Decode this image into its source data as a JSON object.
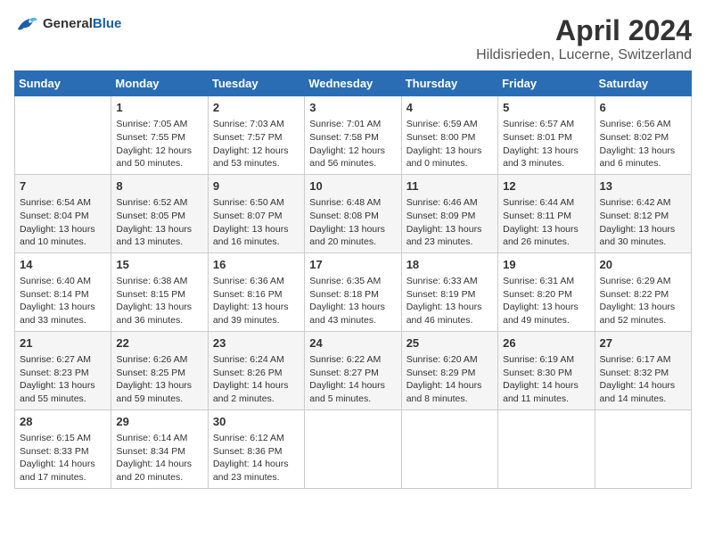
{
  "header": {
    "logo_general": "General",
    "logo_blue": "Blue",
    "month": "April 2024",
    "location": "Hildisrieden, Lucerne, Switzerland"
  },
  "weekdays": [
    "Sunday",
    "Monday",
    "Tuesday",
    "Wednesday",
    "Thursday",
    "Friday",
    "Saturday"
  ],
  "weeks": [
    [
      {
        "day": "",
        "sunrise": "",
        "sunset": "",
        "daylight": ""
      },
      {
        "day": "1",
        "sunrise": "Sunrise: 7:05 AM",
        "sunset": "Sunset: 7:55 PM",
        "daylight": "Daylight: 12 hours and 50 minutes."
      },
      {
        "day": "2",
        "sunrise": "Sunrise: 7:03 AM",
        "sunset": "Sunset: 7:57 PM",
        "daylight": "Daylight: 12 hours and 53 minutes."
      },
      {
        "day": "3",
        "sunrise": "Sunrise: 7:01 AM",
        "sunset": "Sunset: 7:58 PM",
        "daylight": "Daylight: 12 hours and 56 minutes."
      },
      {
        "day": "4",
        "sunrise": "Sunrise: 6:59 AM",
        "sunset": "Sunset: 8:00 PM",
        "daylight": "Daylight: 13 hours and 0 minutes."
      },
      {
        "day": "5",
        "sunrise": "Sunrise: 6:57 AM",
        "sunset": "Sunset: 8:01 PM",
        "daylight": "Daylight: 13 hours and 3 minutes."
      },
      {
        "day": "6",
        "sunrise": "Sunrise: 6:56 AM",
        "sunset": "Sunset: 8:02 PM",
        "daylight": "Daylight: 13 hours and 6 minutes."
      }
    ],
    [
      {
        "day": "7",
        "sunrise": "Sunrise: 6:54 AM",
        "sunset": "Sunset: 8:04 PM",
        "daylight": "Daylight: 13 hours and 10 minutes."
      },
      {
        "day": "8",
        "sunrise": "Sunrise: 6:52 AM",
        "sunset": "Sunset: 8:05 PM",
        "daylight": "Daylight: 13 hours and 13 minutes."
      },
      {
        "day": "9",
        "sunrise": "Sunrise: 6:50 AM",
        "sunset": "Sunset: 8:07 PM",
        "daylight": "Daylight: 13 hours and 16 minutes."
      },
      {
        "day": "10",
        "sunrise": "Sunrise: 6:48 AM",
        "sunset": "Sunset: 8:08 PM",
        "daylight": "Daylight: 13 hours and 20 minutes."
      },
      {
        "day": "11",
        "sunrise": "Sunrise: 6:46 AM",
        "sunset": "Sunset: 8:09 PM",
        "daylight": "Daylight: 13 hours and 23 minutes."
      },
      {
        "day": "12",
        "sunrise": "Sunrise: 6:44 AM",
        "sunset": "Sunset: 8:11 PM",
        "daylight": "Daylight: 13 hours and 26 minutes."
      },
      {
        "day": "13",
        "sunrise": "Sunrise: 6:42 AM",
        "sunset": "Sunset: 8:12 PM",
        "daylight": "Daylight: 13 hours and 30 minutes."
      }
    ],
    [
      {
        "day": "14",
        "sunrise": "Sunrise: 6:40 AM",
        "sunset": "Sunset: 8:14 PM",
        "daylight": "Daylight: 13 hours and 33 minutes."
      },
      {
        "day": "15",
        "sunrise": "Sunrise: 6:38 AM",
        "sunset": "Sunset: 8:15 PM",
        "daylight": "Daylight: 13 hours and 36 minutes."
      },
      {
        "day": "16",
        "sunrise": "Sunrise: 6:36 AM",
        "sunset": "Sunset: 8:16 PM",
        "daylight": "Daylight: 13 hours and 39 minutes."
      },
      {
        "day": "17",
        "sunrise": "Sunrise: 6:35 AM",
        "sunset": "Sunset: 8:18 PM",
        "daylight": "Daylight: 13 hours and 43 minutes."
      },
      {
        "day": "18",
        "sunrise": "Sunrise: 6:33 AM",
        "sunset": "Sunset: 8:19 PM",
        "daylight": "Daylight: 13 hours and 46 minutes."
      },
      {
        "day": "19",
        "sunrise": "Sunrise: 6:31 AM",
        "sunset": "Sunset: 8:20 PM",
        "daylight": "Daylight: 13 hours and 49 minutes."
      },
      {
        "day": "20",
        "sunrise": "Sunrise: 6:29 AM",
        "sunset": "Sunset: 8:22 PM",
        "daylight": "Daylight: 13 hours and 52 minutes."
      }
    ],
    [
      {
        "day": "21",
        "sunrise": "Sunrise: 6:27 AM",
        "sunset": "Sunset: 8:23 PM",
        "daylight": "Daylight: 13 hours and 55 minutes."
      },
      {
        "day": "22",
        "sunrise": "Sunrise: 6:26 AM",
        "sunset": "Sunset: 8:25 PM",
        "daylight": "Daylight: 13 hours and 59 minutes."
      },
      {
        "day": "23",
        "sunrise": "Sunrise: 6:24 AM",
        "sunset": "Sunset: 8:26 PM",
        "daylight": "Daylight: 14 hours and 2 minutes."
      },
      {
        "day": "24",
        "sunrise": "Sunrise: 6:22 AM",
        "sunset": "Sunset: 8:27 PM",
        "daylight": "Daylight: 14 hours and 5 minutes."
      },
      {
        "day": "25",
        "sunrise": "Sunrise: 6:20 AM",
        "sunset": "Sunset: 8:29 PM",
        "daylight": "Daylight: 14 hours and 8 minutes."
      },
      {
        "day": "26",
        "sunrise": "Sunrise: 6:19 AM",
        "sunset": "Sunset: 8:30 PM",
        "daylight": "Daylight: 14 hours and 11 minutes."
      },
      {
        "day": "27",
        "sunrise": "Sunrise: 6:17 AM",
        "sunset": "Sunset: 8:32 PM",
        "daylight": "Daylight: 14 hours and 14 minutes."
      }
    ],
    [
      {
        "day": "28",
        "sunrise": "Sunrise: 6:15 AM",
        "sunset": "Sunset: 8:33 PM",
        "daylight": "Daylight: 14 hours and 17 minutes."
      },
      {
        "day": "29",
        "sunrise": "Sunrise: 6:14 AM",
        "sunset": "Sunset: 8:34 PM",
        "daylight": "Daylight: 14 hours and 20 minutes."
      },
      {
        "day": "30",
        "sunrise": "Sunrise: 6:12 AM",
        "sunset": "Sunset: 8:36 PM",
        "daylight": "Daylight: 14 hours and 23 minutes."
      },
      {
        "day": "",
        "sunrise": "",
        "sunset": "",
        "daylight": ""
      },
      {
        "day": "",
        "sunrise": "",
        "sunset": "",
        "daylight": ""
      },
      {
        "day": "",
        "sunrise": "",
        "sunset": "",
        "daylight": ""
      },
      {
        "day": "",
        "sunrise": "",
        "sunset": "",
        "daylight": ""
      }
    ]
  ]
}
